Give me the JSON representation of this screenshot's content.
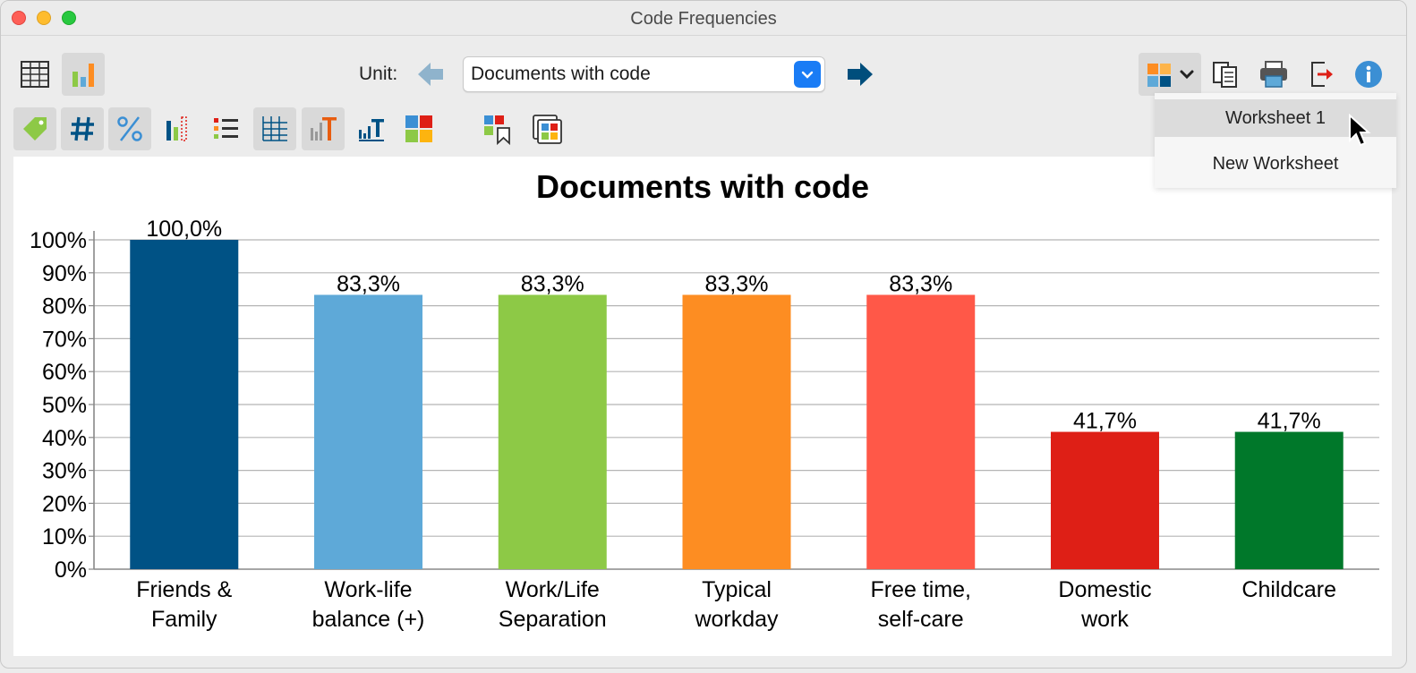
{
  "window": {
    "title": "Code Frequencies"
  },
  "toolbar": {
    "unit_label": "Unit:",
    "unit_value": "Documents with code"
  },
  "dropdown": {
    "items": [
      "Worksheet 1",
      "New Worksheet"
    ]
  },
  "chart_data": {
    "type": "bar",
    "title": "Documents with code",
    "categories": [
      [
        "Friends &",
        "Family"
      ],
      [
        "Work-life",
        "balance (+)"
      ],
      [
        "Work/Life",
        "Separation"
      ],
      [
        "Typical",
        "workday"
      ],
      [
        "Free time,",
        "self-care"
      ],
      [
        "Domestic",
        "work"
      ],
      [
        "Childcare"
      ]
    ],
    "values": [
      100.0,
      83.3,
      83.3,
      83.3,
      83.3,
      41.7,
      41.7
    ],
    "data_labels": [
      "100,0%",
      "83,3%",
      "83,3%",
      "83,3%",
      "83,3%",
      "41,7%",
      "41,7%"
    ],
    "colors": [
      "#005285",
      "#5ea9d8",
      "#8dc946",
      "#fd8d22",
      "#ff5848",
      "#de1f16",
      "#00782a"
    ],
    "ylim": [
      0,
      100
    ],
    "yticks": [
      "0%",
      "10%",
      "20%",
      "30%",
      "40%",
      "50%",
      "60%",
      "70%",
      "80%",
      "90%",
      "100%"
    ],
    "grid": true,
    "legend": "none"
  }
}
